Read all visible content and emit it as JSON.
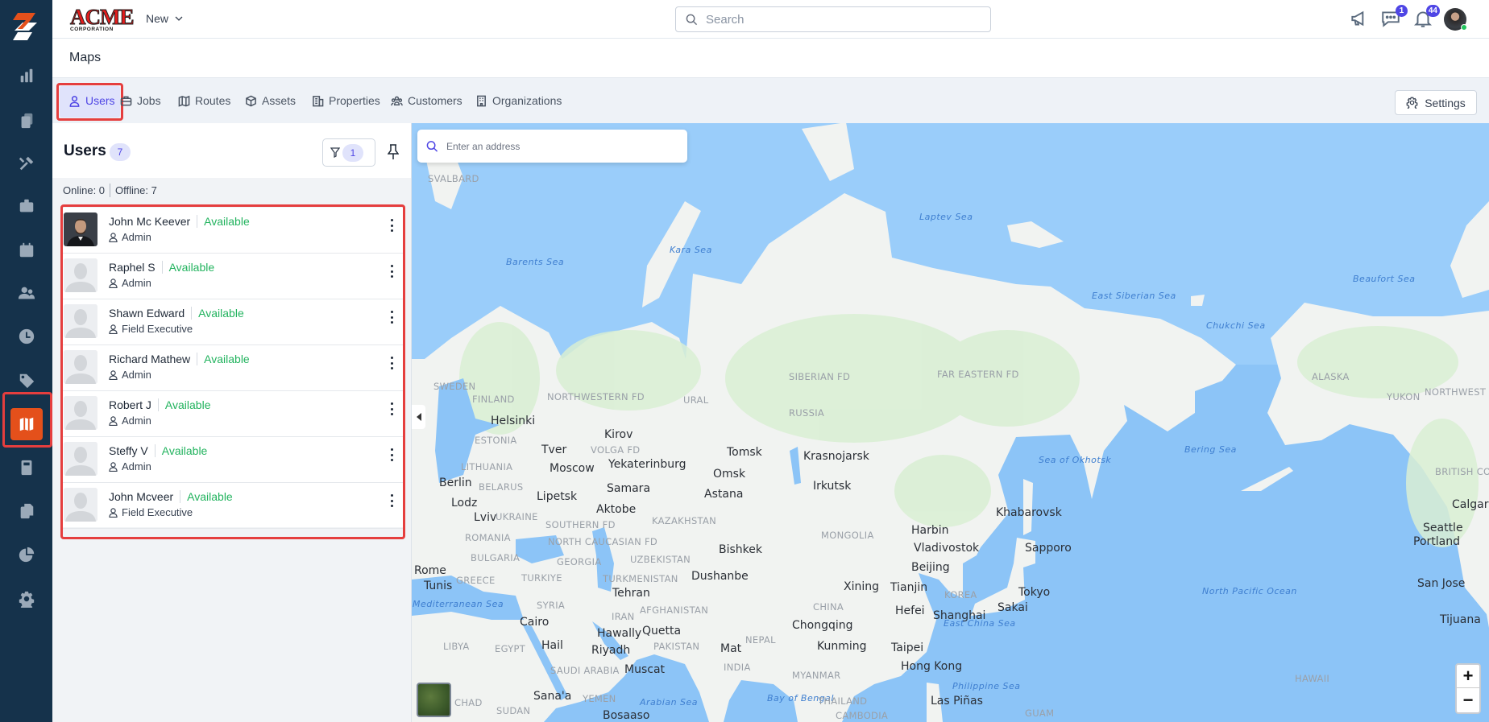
{
  "app": {
    "brand_top": "ACME",
    "brand_bottom": "CORPORATION",
    "new_label": "New"
  },
  "search": {
    "placeholder": "Search"
  },
  "header": {
    "chat_badge": "1",
    "notifications_badge": "44"
  },
  "page": {
    "title": "Maps"
  },
  "tabs": [
    {
      "label": "Users",
      "active": true
    },
    {
      "label": "Jobs"
    },
    {
      "label": "Routes"
    },
    {
      "label": "Assets"
    },
    {
      "label": "Properties"
    },
    {
      "label": "Customers"
    },
    {
      "label": "Organizations"
    }
  ],
  "settings_label": "Settings",
  "panel": {
    "title": "Users",
    "count": "7",
    "filter_count": "1",
    "online": "Online: 0",
    "offline": "Offline: 7",
    "users": [
      {
        "name": "John Mc Keever",
        "status": "Available",
        "role": "Admin",
        "photo": true
      },
      {
        "name": "Raphel S",
        "status": "Available",
        "role": "Admin"
      },
      {
        "name": "Shawn Edward",
        "status": "Available",
        "role": "Field Executive"
      },
      {
        "name": "Richard Mathew",
        "status": "Available",
        "role": "Admin"
      },
      {
        "name": "Robert J",
        "status": "Available",
        "role": "Admin"
      },
      {
        "name": "Steffy V",
        "status": "Available",
        "role": "Admin"
      },
      {
        "name": "John Mcveer",
        "status": "Available",
        "role": "Field Executive"
      }
    ]
  },
  "map": {
    "address_placeholder": "Enter an address",
    "zoom_in": "+",
    "zoom_out": "−",
    "colors": {
      "ocean": "#8cc4f7",
      "land": "#f1f3f1",
      "forest": "#d9efd3"
    },
    "labels": [
      {
        "text": "SVALBARD",
        "kind": "country"
      },
      {
        "text": "Laptev Sea",
        "kind": "sea"
      },
      {
        "text": "Kara Sea",
        "kind": "sea"
      },
      {
        "text": "Barents Sea",
        "kind": "sea"
      },
      {
        "text": "Beaufort Sea",
        "kind": "sea"
      },
      {
        "text": "East Siberian Sea",
        "kind": "sea"
      },
      {
        "text": "Chukchi Sea",
        "kind": "sea"
      },
      {
        "text": "SIBERIAN FD",
        "kind": "country"
      },
      {
        "text": "FAR EASTERN FD",
        "kind": "country"
      },
      {
        "text": "ALASKA",
        "kind": "country"
      },
      {
        "text": "SWEDEN",
        "kind": "country"
      },
      {
        "text": "FINLAND",
        "kind": "country"
      },
      {
        "text": "NORTHWESTERN FD",
        "kind": "country"
      },
      {
        "text": "URAL",
        "kind": "country"
      },
      {
        "text": "Helsinki",
        "kind": "city"
      },
      {
        "text": "RUSSIA",
        "kind": "country"
      },
      {
        "text": "ESTONIA",
        "kind": "country"
      },
      {
        "text": "Kirov",
        "kind": "city"
      },
      {
        "text": "Tver",
        "kind": "city"
      },
      {
        "text": "VOLGA FD",
        "kind": "country"
      },
      {
        "text": "Tomsk",
        "kind": "city"
      },
      {
        "text": "Krasnojarsk",
        "kind": "city"
      },
      {
        "text": "Moscow",
        "kind": "city"
      },
      {
        "text": "Yekaterinburg",
        "kind": "city"
      },
      {
        "text": "LITHUANIA",
        "kind": "country"
      },
      {
        "text": "Omsk",
        "kind": "city"
      },
      {
        "text": "Berlin",
        "kind": "city"
      },
      {
        "text": "BELARUS",
        "kind": "country"
      },
      {
        "text": "Lipetsk",
        "kind": "city"
      },
      {
        "text": "Samara",
        "kind": "city"
      },
      {
        "text": "Astana",
        "kind": "city"
      },
      {
        "text": "Irkutsk",
        "kind": "city"
      },
      {
        "text": "Lodz",
        "kind": "city"
      },
      {
        "text": "Aktobe",
        "kind": "city"
      },
      {
        "text": "Lviv",
        "kind": "city"
      },
      {
        "text": "UKRAINE",
        "kind": "country"
      },
      {
        "text": "SOUTHERN FD",
        "kind": "country"
      },
      {
        "text": "KAZAKHSTAN",
        "kind": "country"
      },
      {
        "text": "ROMANIA",
        "kind": "country"
      },
      {
        "text": "NORTH CAUCASIAN FD",
        "kind": "country"
      },
      {
        "text": "MONGOLIA",
        "kind": "country"
      },
      {
        "text": "Harbin",
        "kind": "city"
      },
      {
        "text": "Bishkek",
        "kind": "city"
      },
      {
        "text": "Vladivostok",
        "kind": "city"
      },
      {
        "text": "BULGARIA",
        "kind": "country"
      },
      {
        "text": "GEORGIA",
        "kind": "country"
      },
      {
        "text": "UZBEKISTAN",
        "kind": "country"
      },
      {
        "text": "Beijing",
        "kind": "city"
      },
      {
        "text": "Rome",
        "kind": "city"
      },
      {
        "text": "GREECE",
        "kind": "country"
      },
      {
        "text": "TURKIYE",
        "kind": "country"
      },
      {
        "text": "TURKMENISTAN",
        "kind": "country"
      },
      {
        "text": "Dushanbe",
        "kind": "city"
      },
      {
        "text": "Xining",
        "kind": "city"
      },
      {
        "text": "Tianjin",
        "kind": "city"
      },
      {
        "text": "Tunis",
        "kind": "city"
      },
      {
        "text": "Tehran",
        "kind": "city"
      },
      {
        "text": "KOREA",
        "kind": "country"
      },
      {
        "text": "Mediterranean Sea",
        "kind": "sea"
      },
      {
        "text": "SYRIA",
        "kind": "country"
      },
      {
        "text": "AFGHANISTAN",
        "kind": "country"
      },
      {
        "text": "CHINA",
        "kind": "country"
      },
      {
        "text": "Hefei",
        "kind": "city"
      },
      {
        "text": "Shanghai",
        "kind": "city"
      },
      {
        "text": "IRAN",
        "kind": "country"
      },
      {
        "text": "Cairo",
        "kind": "city"
      },
      {
        "text": "Chongqing",
        "kind": "city"
      },
      {
        "text": "Hawally",
        "kind": "city"
      },
      {
        "text": "Quetta",
        "kind": "city"
      },
      {
        "text": "LIBYA",
        "kind": "country"
      },
      {
        "text": "EGYPT",
        "kind": "country"
      },
      {
        "text": "Hail",
        "kind": "city"
      },
      {
        "text": "PAKISTAN",
        "kind": "country"
      },
      {
        "text": "NEPAL",
        "kind": "country"
      },
      {
        "text": "Mat",
        "kind": "city"
      },
      {
        "text": "Kunming",
        "kind": "city"
      },
      {
        "text": "Taipei",
        "kind": "city"
      },
      {
        "text": "Riyadh",
        "kind": "city"
      },
      {
        "text": "East China Sea",
        "kind": "sea"
      },
      {
        "text": "SAUDI ARABIA",
        "kind": "country"
      },
      {
        "text": "Muscat",
        "kind": "city"
      },
      {
        "text": "INDIA",
        "kind": "country"
      },
      {
        "text": "MYANMAR",
        "kind": "country"
      },
      {
        "text": "Hong Kong",
        "kind": "city"
      },
      {
        "text": "Sana'a",
        "kind": "city"
      },
      {
        "text": "YEMEN",
        "kind": "country"
      },
      {
        "text": "Arabian Sea",
        "kind": "sea"
      },
      {
        "text": "Bay of Bengal",
        "kind": "sea"
      },
      {
        "text": "THAILAND",
        "kind": "country"
      },
      {
        "text": "CHAD",
        "kind": "country"
      },
      {
        "text": "SUDAN",
        "kind": "country"
      },
      {
        "text": "Bosaaso",
        "kind": "city"
      },
      {
        "text": "CAMBODIA",
        "kind": "country"
      },
      {
        "text": "Las Piñas",
        "kind": "city"
      },
      {
        "text": "YUKON",
        "kind": "country"
      },
      {
        "text": "NORTHWEST TER",
        "kind": "country"
      },
      {
        "text": "Bering Sea",
        "kind": "sea"
      },
      {
        "text": "Sea of Okhotsk",
        "kind": "sea"
      },
      {
        "text": "BRITISH COLUMBIA",
        "kind": "country"
      },
      {
        "text": "Calgary",
        "kind": "city"
      },
      {
        "text": "Khabarovsk",
        "kind": "city"
      },
      {
        "text": "Seattle",
        "kind": "city"
      },
      {
        "text": "Portland",
        "kind": "city"
      },
      {
        "text": "Sapporo",
        "kind": "city"
      },
      {
        "text": "San Jose",
        "kind": "city"
      },
      {
        "text": "Tokyo",
        "kind": "city"
      },
      {
        "text": "Sakai",
        "kind": "city"
      },
      {
        "text": "North Pacific Ocean",
        "kind": "sea"
      },
      {
        "text": "Tijuana",
        "kind": "city"
      },
      {
        "text": "HAWAII",
        "kind": "country"
      },
      {
        "text": "Philippine Sea",
        "kind": "sea"
      },
      {
        "text": "GUAM",
        "kind": "country"
      }
    ]
  }
}
